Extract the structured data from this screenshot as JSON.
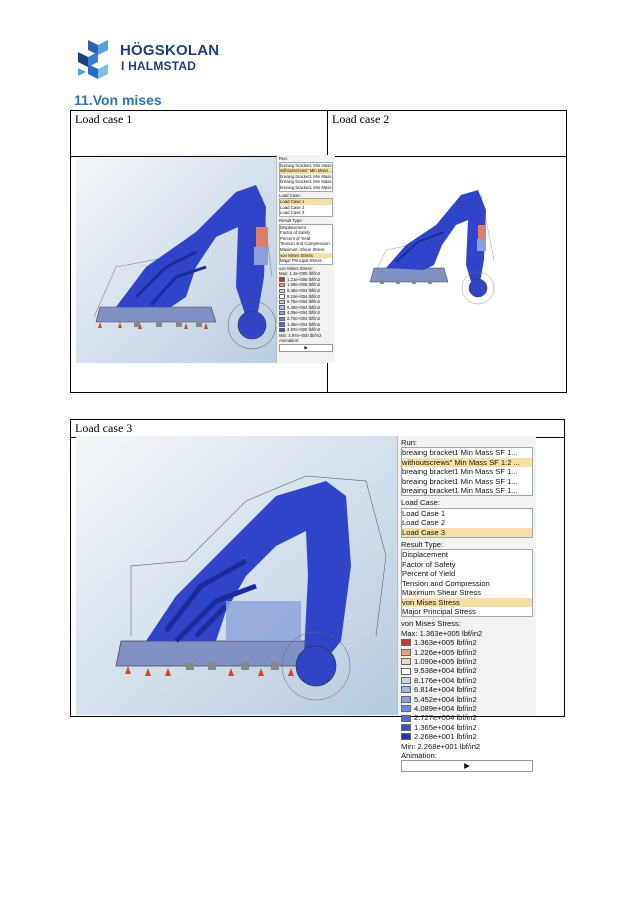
{
  "logo": {
    "line1": "HÖGSKOLAN",
    "line2": "I HALMSTAD"
  },
  "section_heading": "11.Von mises",
  "table1": {
    "col1_header": "Load case 1",
    "col2_header": "Load case 2"
  },
  "table2": {
    "header": "Load case 3"
  },
  "panel1": {
    "run_label": "Run:",
    "runs": [
      "breaing bracket1 Min Mass ...",
      "withoutscrews\" Min Mass ...",
      "breaing bracket1 Min Mass ...",
      "breaing bracket1 Min Mass ...",
      "breaing bracket1 Min Mass ..."
    ],
    "load_case_label": "Load Case:",
    "load_cases": [
      "Load Case 1",
      "Load Case 2",
      "Load Case 3"
    ],
    "result_type_label": "Result Type:",
    "result_types": [
      "Displacement",
      "Factor of Safety",
      "Percent of Yield",
      "Tension and Compression",
      "Maximum Shear Stress",
      "von Mises Stress",
      "Major Principal Stress"
    ],
    "stress_label": "von Mises Stress:",
    "max": "Max:  1.3e+005 lbf/in2",
    "legend": [
      "1.21e+005 lbf/in2",
      "1.08e+005 lbf/in2",
      "9.45e+004 lbf/in2",
      "8.10e+004 lbf/in2",
      "6.75e+004 lbf/in2",
      "5.40e+004 lbf/in2",
      "4.05e+004 lbf/in2",
      "2.70e+004 lbf/in2",
      "1.35e+004 lbf/in2",
      "4.97e+000 lbf/in2"
    ],
    "min": "Min:  4.97e+000 lbf/in2",
    "animation_label": "Animation:"
  },
  "panel3": {
    "run_label": "Run:",
    "runs": [
      "breaing bracket1 Min Mass SF 1...",
      "withoutscrews\" Min Mass SF 1:2 ...",
      "breaing bracket1 Min Mass SF 1...",
      "breaing bracket1 Min Mass SF 1...",
      "breaing bracket1 Min Mass SF 1..."
    ],
    "load_case_label": "Load Case:",
    "load_cases": [
      "Load Case 1",
      "Load Case 2",
      "Load Case 3"
    ],
    "result_type_label": "Result Type:",
    "result_types": [
      "Displacement",
      "Factor of Safety",
      "Percent of Yield",
      "Tension and Compression",
      "Maximum Shear Stress",
      "von Mises Stress",
      "Major Principal Stress"
    ],
    "stress_label": "von Mises Stress:",
    "max": "Max:   1.363e+005 lbf/in2",
    "legend": [
      "1.363e+005 lbf/in2",
      "1.226e+005 lbf/in2",
      "1.090e+005 lbf/in2",
      "9.538e+004 lbf/in2",
      "8.176e+004 lbf/in2",
      "6.814e+004 lbf/in2",
      "5.452e+004 lbf/in2",
      "4.089e+004 lbf/in2",
      "2.727e+004 lbf/in2",
      "1.365e+004 lbf/in2",
      "2.268e+001 lbf/in2"
    ],
    "min": "Min:   2.268e+001 lbf/in2",
    "animation_label": "Animation:",
    "play_symbol": "▶"
  },
  "legend_colors": [
    "#c0392b",
    "#e8a07c",
    "#f2d2bf",
    "#ffffff",
    "#c9d3f0",
    "#a8b7ea",
    "#8b9ee5",
    "#6f85de",
    "#5469d6",
    "#3a4fcb",
    "#2234b8"
  ]
}
